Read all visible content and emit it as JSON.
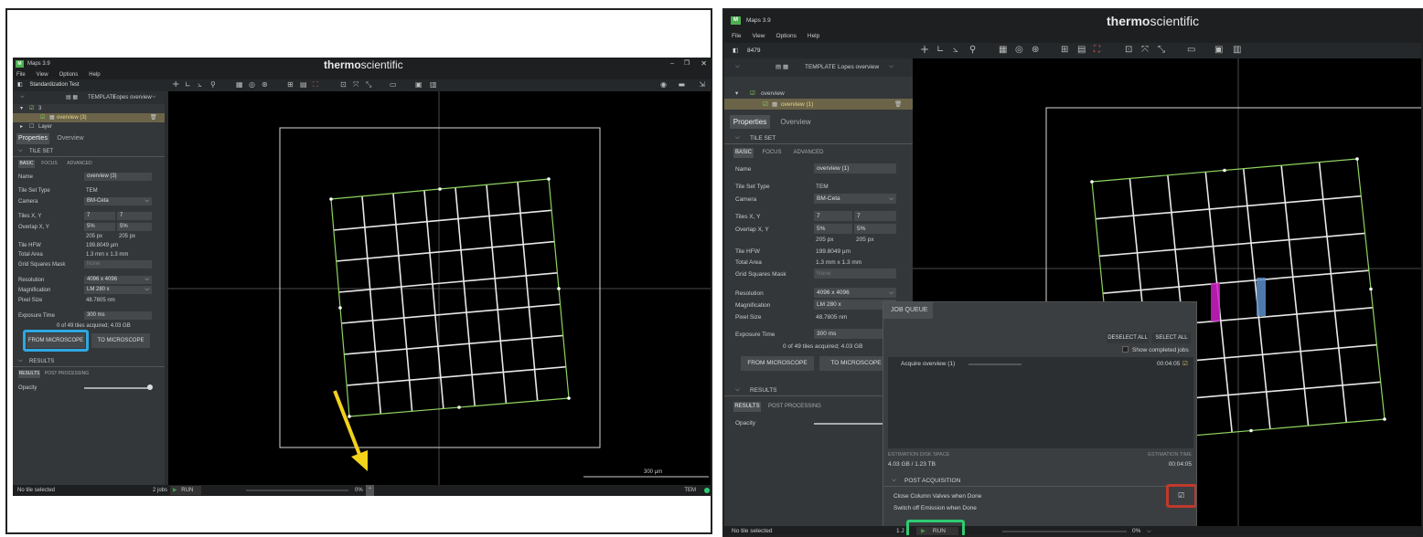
{
  "left": {
    "app_title": "Maps 3.9",
    "brand_bold": "thermo",
    "brand_light": "scientific",
    "window_controls": [
      "–",
      "❐",
      "✕"
    ],
    "menu": [
      "File",
      "View",
      "Options",
      "Help"
    ],
    "project_name": "Standardization Test",
    "template_label": "TEMPLATE",
    "template_value": "Lopes overview",
    "tree": {
      "root_label": "3",
      "child_label": "overview (3)",
      "layer_label": "Layer"
    },
    "tabs": [
      "Properties",
      "Overview"
    ],
    "section_tileset": "TILE SET",
    "subtabs": [
      "BASIC",
      "FOCUS",
      "ADVANCED"
    ],
    "props": {
      "name_label": "Name",
      "name_value": "overview (3)",
      "type_label": "Tile Set Type",
      "type_value": "TEM",
      "camera_label": "Camera",
      "camera_value": "BM-Ceta",
      "tiles_label": "Tiles X, Y",
      "tiles_x": "7",
      "tiles_y": "7",
      "overlap_label": "Overlap X, Y",
      "overlap_x": "5%",
      "overlap_y": "5%",
      "overlap_px_x": "205 px",
      "overlap_px_y": "205 px",
      "hfw_label": "Tile HFW",
      "hfw_value": "199.8049 µm",
      "area_label": "Total Area",
      "area_value": "1.3 mm x 1.3 mm",
      "mask_label": "Grid Squares Mask",
      "mask_value": "None",
      "res_label": "Resolution",
      "res_value": "4096 x 4096",
      "mag_label": "Magnification",
      "mag_value": "LM 280 x",
      "pix_label": "Pixel Size",
      "pix_value": "48.7805 nm",
      "exp_label": "Exposure Time",
      "exp_value": "300 ms",
      "acq_info": "0 of 49 tiles acquired; 4.03 GB"
    },
    "btn_from": "FROM MICROSCOPE",
    "btn_to": "TO MICROSCOPE",
    "section_results": "RESULTS",
    "results_tabs": [
      "RESULTS",
      "POST PROCESSING"
    ],
    "opacity_label": "Opacity",
    "status_left": "No tile selected",
    "jobs": "2 jobs",
    "run": "RUN",
    "progress_pct": "0%",
    "status_right": "TEM",
    "scale_label": "300 µm"
  },
  "right": {
    "app_title": "Maps 3.9",
    "brand_bold": "thermo",
    "brand_light": "scientific",
    "menu": [
      "File",
      "View",
      "Options",
      "Help"
    ],
    "project_name": "8479",
    "template_label": "TEMPLATE",
    "template_value": "Lopes overview",
    "tree": {
      "root_label": "overview",
      "child_label": "overview (1)"
    },
    "tabs": [
      "Properties",
      "Overview"
    ],
    "section_tileset": "TILE SET",
    "subtabs": [
      "BASIC",
      "FOCUS",
      "ADVANCED"
    ],
    "props": {
      "name_label": "Name",
      "name_value": "overview (1)",
      "type_label": "Tile Set Type",
      "type_value": "TEM",
      "camera_label": "Camera",
      "camera_value": "BM-Ceta",
      "tiles_label": "Tiles X, Y",
      "tiles_x": "7",
      "tiles_y": "7",
      "overlap_label": "Overlap X, Y",
      "overlap_x": "5%",
      "overlap_y": "5%",
      "overlap_px_x": "205 px",
      "overlap_px_y": "205 px",
      "hfw_label": "Tile HFW",
      "hfw_value": "199.8049 µm",
      "area_label": "Total Area",
      "area_value": "1.3 mm x 1.3 mm",
      "mask_label": "Grid Squares Mask",
      "mask_value": "None",
      "res_label": "Resolution",
      "res_value": "4096 x 4096",
      "mag_label": "Magnification",
      "mag_value": "LM 280 x",
      "pix_label": "Pixel Size",
      "pix_value": "48.7805 nm",
      "exp_label": "Exposure Time",
      "exp_value": "300 ms",
      "acq_info": "0 of 49 tiles acquired; 4.03 GB"
    },
    "btn_from": "FROM MICROSCOPE",
    "btn_to": "TO MICROSCOPE",
    "section_results": "RESULTS",
    "results_tabs": [
      "RESULTS",
      "POST PROCESSING"
    ],
    "opacity_label": "Opacity",
    "job_queue": {
      "title": "JOB QUEUE",
      "deselect_all": "DESELECT ALL",
      "select_all": "SELECT ALL",
      "show_completed": "Show completed jobs",
      "job_name": "Acquire overview (1)",
      "job_time": "00:04:05",
      "disk_label": "ESTIMATION DISK SPACE",
      "disk_value": "4.03 GB / 1.23 TB",
      "time_label": "ESTIMATION TIME",
      "time_value": "00:04:05",
      "post_title": "POST ACQUISITION",
      "close_valves": "Close Column Valves when Done",
      "switch_emission": "Switch off Emission when Done"
    },
    "status_left": "No tile selected",
    "jobs": "1 J",
    "run": "RUN",
    "progress_pct": "0%"
  },
  "colors": {
    "grid": "#8dd35f",
    "blue_highlight": "#2fa8e1",
    "red_highlight": "#c0392b",
    "green_highlight": "#2ecc71",
    "arrow": "#f2d21b",
    "magenta": "#d11fc8",
    "steelblue": "#5b8fc9"
  }
}
